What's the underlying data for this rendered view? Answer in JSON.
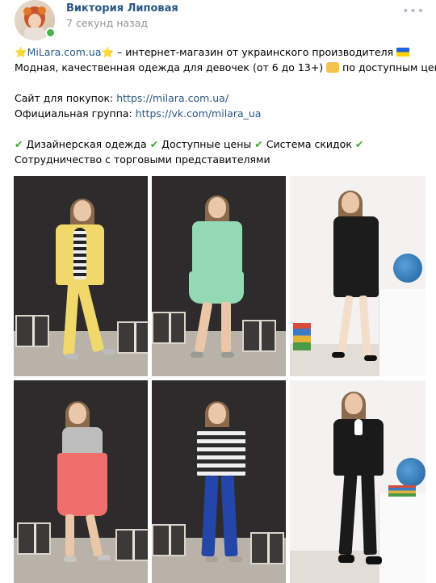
{
  "author": {
    "name": "Виктория Липовая",
    "time": "7 секунд назад",
    "online": true
  },
  "post": {
    "line1_star_left": "⭐",
    "line1_brand": "MiLara.com.ua",
    "line1_star_right": "⭐",
    "line1_rest": " – интернет-магазин от украинского производителя ",
    "line2": "Модная, качественная одежда для девочек (от 6 до 13+) ",
    "line2_end": " по доступным ценам",
    "shop_label": "Сайт для покупок: ",
    "shop_link": "https://milara.com.ua/",
    "group_label": "Официальная группа: ",
    "group_link": "https://vk.com/milara_ua",
    "features": [
      "Дизайнерская одежда",
      "Доступные цены",
      "Система скидок"
    ],
    "check": "✔",
    "last_line": "Сотрудничество с торговыми представителями"
  },
  "photos": [
    {
      "outfit": "yellow cardigan, striped top, yellow pants",
      "bg": "dark",
      "accent": "#f0d86a"
    },
    {
      "outfit": "mint cardigan and skirt",
      "bg": "dark",
      "accent": "#93d9b5"
    },
    {
      "outfit": "black polka-dot cardigan and dress",
      "bg": "light",
      "accent": "#1c1c1c"
    },
    {
      "outfit": "coral dress with grey top",
      "bg": "dark",
      "accent": "#f06e6b"
    },
    {
      "outfit": "striped top and blue jeans",
      "bg": "dark",
      "accent": "#2346a8"
    },
    {
      "outfit": "black track suit with white collar",
      "bg": "light",
      "accent": "#1a1a1a"
    }
  ],
  "colors": {
    "link": "#2a5885",
    "time": "#939393",
    "online": "#4bb34b"
  }
}
